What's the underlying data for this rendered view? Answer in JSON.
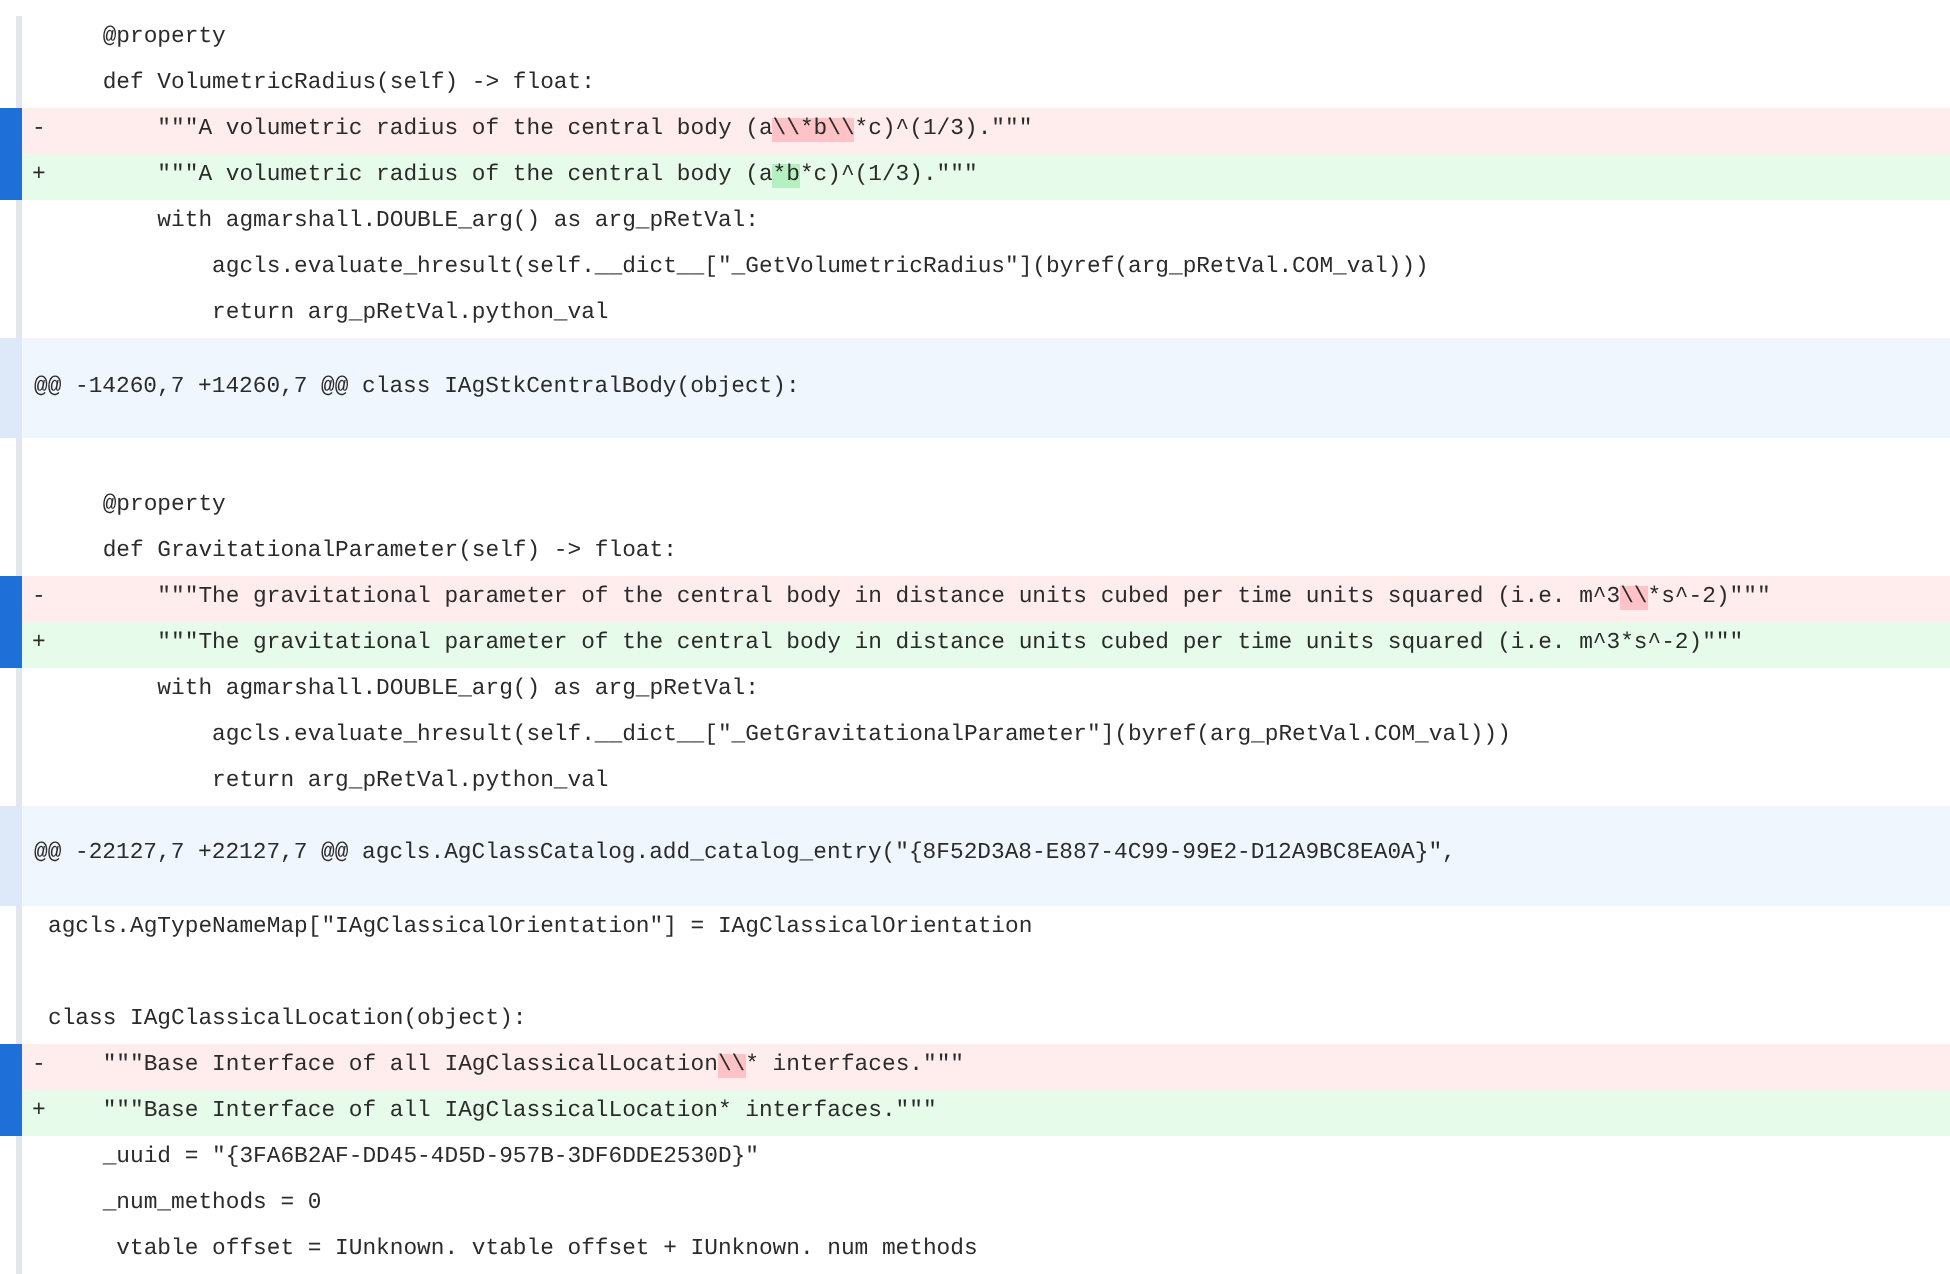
{
  "lines": [
    {
      "kind": "context",
      "text": "    @property"
    },
    {
      "kind": "context",
      "text": "    def VolumetricRadius(self) -> float:"
    },
    {
      "kind": "removed",
      "marker": "-",
      "segments": [
        {
          "text": "        \"\"\"A volumetric radius of the central body (a",
          "changed": false
        },
        {
          "text": "\\\\*b\\\\",
          "changed": true
        },
        {
          "text": "*c)^(1/3).\"\"\"",
          "changed": false
        }
      ]
    },
    {
      "kind": "added",
      "marker": "+",
      "segments": [
        {
          "text": "        \"\"\"A volumetric radius of the central body (a",
          "changed": false
        },
        {
          "text": "*b",
          "changed": true
        },
        {
          "text": "*c)^(1/3).\"\"\"",
          "changed": false
        }
      ]
    },
    {
      "kind": "context",
      "text": "        with agmarshall.DOUBLE_arg() as arg_pRetVal:"
    },
    {
      "kind": "context",
      "text": "            agcls.evaluate_hresult(self.__dict__[\"_GetVolumetricRadius\"](byref(arg_pRetVal.COM_val)))"
    },
    {
      "kind": "context",
      "text": "            return arg_pRetVal.python_val"
    },
    {
      "kind": "hunk",
      "text": "@@ -14260,7 +14260,7 @@ class IAgStkCentralBody(object):"
    },
    {
      "kind": "blank"
    },
    {
      "kind": "context",
      "text": "    @property"
    },
    {
      "kind": "context",
      "text": "    def GravitationalParameter(self) -> float:"
    },
    {
      "kind": "removed",
      "marker": "-",
      "segments": [
        {
          "text": "        \"\"\"The gravitational parameter of the central body in distance units cubed per time units squared (i.e. m^3",
          "changed": false
        },
        {
          "text": "\\\\",
          "changed": true
        },
        {
          "text": "*s^-2)\"\"\"",
          "changed": false
        }
      ]
    },
    {
      "kind": "added",
      "marker": "+",
      "segments": [
        {
          "text": "        \"\"\"The gravitational parameter of the central body in distance units cubed per time units squared (i.e. m^3*s^-2)\"\"\"",
          "changed": false
        }
      ]
    },
    {
      "kind": "context",
      "text": "        with agmarshall.DOUBLE_arg() as arg_pRetVal:"
    },
    {
      "kind": "context",
      "text": "            agcls.evaluate_hresult(self.__dict__[\"_GetGravitationalParameter\"](byref(arg_pRetVal.COM_val)))"
    },
    {
      "kind": "context",
      "text": "            return arg_pRetVal.python_val"
    },
    {
      "kind": "hunk",
      "text": "@@ -22127,7 +22127,7 @@ agcls.AgClassCatalog.add_catalog_entry(\"{8F52D3A8-E887-4C99-99E2-D12A9BC8EA0A}\","
    },
    {
      "kind": "context",
      "text": "agcls.AgTypeNameMap[\"IAgClassicalOrientation\"] = IAgClassicalOrientation"
    },
    {
      "kind": "blank"
    },
    {
      "kind": "context",
      "text": "class IAgClassicalLocation(object):"
    },
    {
      "kind": "removed",
      "marker": "-",
      "segments": [
        {
          "text": "    \"\"\"Base Interface of all IAgClassicalLocation",
          "changed": false
        },
        {
          "text": "\\\\",
          "changed": true
        },
        {
          "text": "* interfaces.\"\"\"",
          "changed": false
        }
      ]
    },
    {
      "kind": "added",
      "marker": "+",
      "segments": [
        {
          "text": "    \"\"\"Base Interface of all IAgClassicalLocation* interfaces.\"\"\"",
          "changed": false
        }
      ]
    },
    {
      "kind": "context",
      "text": "    _uuid = \"{3FA6B2AF-DD45-4D5D-957B-3DF6DDE2530D}\""
    },
    {
      "kind": "context",
      "text": "    _num_methods = 0"
    },
    {
      "kind": "context",
      "text": "     vtable offset = IUnknown. vtable offset + IUnknown. num methods"
    }
  ]
}
